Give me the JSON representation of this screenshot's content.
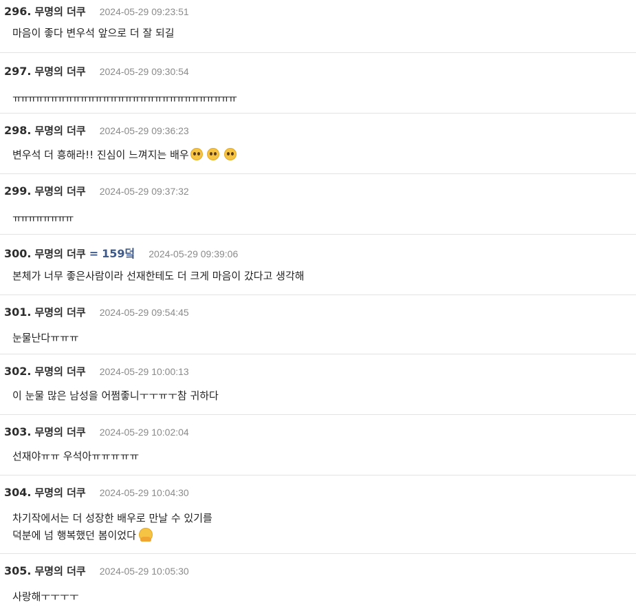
{
  "comments": [
    {
      "num": "296.",
      "author": "무명의 더쿠",
      "time": "2024-05-29 09:23:51",
      "lines": [
        "마음이 좋다 변우석 앞으로 더 잘 되길"
      ]
    },
    {
      "num": "297.",
      "author": "무명의 더쿠",
      "time": "2024-05-29 09:30:54",
      "lines": [
        "ㅠㅠㅠㅠㅠㅠㅠㅠㅠㅠㅠㅠㅠㅠㅠㅠㅠㅠㅠㅠㅠㅠㅠㅠㅠㅠㅠㅠㅠㅠ"
      ]
    },
    {
      "num": "298.",
      "author": "무명의 더쿠",
      "time": "2024-05-29 09:36:23",
      "lines": [
        "변우석 더 흥해라!! 진심이 느껴지는 배우"
      ],
      "emoji": "pleading-face-icon",
      "emoji_count": 3
    },
    {
      "num": "299.",
      "author": "무명의 더쿠",
      "time": "2024-05-29 09:37:32",
      "lines": [
        "ㅠㅠㅠㅠㅠㅠㅠㅠ"
      ]
    },
    {
      "num": "300.",
      "author": "무명의 더쿠",
      "eq": "=",
      "ref": "159덬",
      "time": "2024-05-29 09:39:06",
      "lines": [
        "본체가 너무 좋은사람이라 선재한테도 더 크게 마음이 갔다고 생각해"
      ]
    },
    {
      "num": "301.",
      "author": "무명의 더쿠",
      "time": "2024-05-29 09:54:45",
      "lines": [
        "눈물난다ㅠㅠㅠ"
      ]
    },
    {
      "num": "302.",
      "author": "무명의 더쿠",
      "time": "2024-05-29 10:00:13",
      "lines": [
        "이 눈물 많은 남성을 어쩜좋니ㅜㅜㅠㅜ참 귀하다"
      ]
    },
    {
      "num": "303.",
      "author": "무명의 더쿠",
      "time": "2024-05-29 10:02:04",
      "lines": [
        "선재야ㅠㅠ 우석아ㅠㅠㅠㅠㅠ"
      ]
    },
    {
      "num": "304.",
      "author": "무명의 더쿠",
      "time": "2024-05-29 10:04:30",
      "lines": [
        "차기작에서는 더 성장한 배우로 만날 수 있기를",
        "덕분에 넘 행복했던 봄이었다"
      ],
      "emoji": "hugging-face-icon",
      "emoji_count": 1
    },
    {
      "num": "305.",
      "author": "무명의 더쿠",
      "time": "2024-05-29 10:05:30",
      "lines": [
        "사랑해ㅜㅜㅜㅜ"
      ]
    }
  ]
}
